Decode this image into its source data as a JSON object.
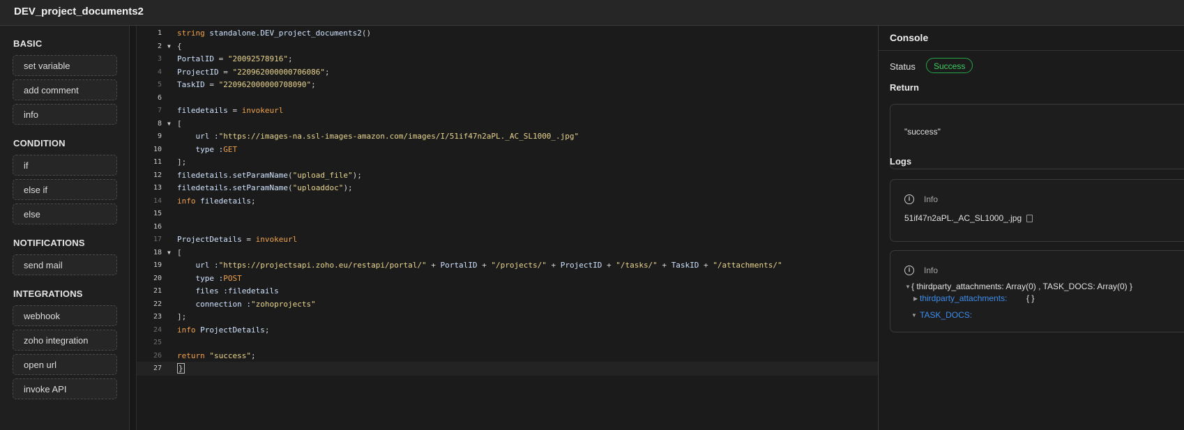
{
  "window": {
    "title": "DEV_project_documents2"
  },
  "sidebar": {
    "sections": [
      {
        "title": "BASIC",
        "items": [
          "set variable",
          "add comment",
          "info"
        ]
      },
      {
        "title": "CONDITION",
        "items": [
          "if",
          "else if",
          "else"
        ]
      },
      {
        "title": "NOTIFICATIONS",
        "items": [
          "send mail"
        ]
      },
      {
        "title": "INTEGRATIONS",
        "items": [
          "webhook",
          "zoho integration",
          "open url",
          "invoke API"
        ]
      }
    ]
  },
  "editor": {
    "lines": [
      {
        "n": "1",
        "fold": false,
        "segments": [
          {
            "t": "string ",
            "c": "kw"
          },
          {
            "t": "standalone.DEV_project_documents2",
            "c": "id"
          },
          {
            "t": "()",
            "c": ""
          }
        ]
      },
      {
        "n": "2",
        "fold": true,
        "segments": [
          {
            "t": "{",
            "c": ""
          }
        ]
      },
      {
        "n": "3",
        "fold": false,
        "segments": [
          {
            "t": "PortalID",
            "c": "id"
          },
          {
            "t": " = ",
            "c": ""
          },
          {
            "t": "\"20092578916\"",
            "c": "str"
          },
          {
            "t": ";",
            "c": ""
          }
        ]
      },
      {
        "n": "4",
        "fold": false,
        "segments": [
          {
            "t": "ProjectID",
            "c": "id"
          },
          {
            "t": " = ",
            "c": ""
          },
          {
            "t": "\"220962000000706086\"",
            "c": "str"
          },
          {
            "t": ";",
            "c": ""
          }
        ]
      },
      {
        "n": "5",
        "fold": false,
        "segments": [
          {
            "t": "TaskID",
            "c": "id"
          },
          {
            "t": " = ",
            "c": ""
          },
          {
            "t": "\"220962000000708090\"",
            "c": "str"
          },
          {
            "t": ";",
            "c": ""
          }
        ]
      },
      {
        "n": "6",
        "fold": false,
        "segments": []
      },
      {
        "n": "7",
        "fold": false,
        "segments": [
          {
            "t": "filedetails",
            "c": "id"
          },
          {
            "t": " = ",
            "c": ""
          },
          {
            "t": "invokeurl",
            "c": "kw"
          }
        ]
      },
      {
        "n": "8",
        "fold": true,
        "segments": [
          {
            "t": "[",
            "c": ""
          }
        ]
      },
      {
        "n": "9",
        "fold": false,
        "segments": [
          {
            "t": "    url :",
            "c": "id"
          },
          {
            "t": "\"https://images-na.ssl-images-amazon.com/images/I/51if47n2aPL._AC_SL1000_.jpg\"",
            "c": "str"
          }
        ]
      },
      {
        "n": "10",
        "fold": false,
        "segments": [
          {
            "t": "    type :",
            "c": "id"
          },
          {
            "t": "GET",
            "c": "kw"
          }
        ]
      },
      {
        "n": "11",
        "fold": false,
        "segments": [
          {
            "t": "];",
            "c": ""
          }
        ]
      },
      {
        "n": "12",
        "fold": false,
        "segments": [
          {
            "t": "filedetails.setParamName",
            "c": "id"
          },
          {
            "t": "(",
            "c": ""
          },
          {
            "t": "\"upload_file\"",
            "c": "str"
          },
          {
            "t": ");",
            "c": ""
          }
        ]
      },
      {
        "n": "13",
        "fold": false,
        "segments": [
          {
            "t": "filedetails.setParamName",
            "c": "id"
          },
          {
            "t": "(",
            "c": ""
          },
          {
            "t": "\"uploaddoc\"",
            "c": "str"
          },
          {
            "t": ");",
            "c": ""
          }
        ]
      },
      {
        "n": "14",
        "fold": false,
        "segments": [
          {
            "t": "info ",
            "c": "kw"
          },
          {
            "t": "filedetails",
            "c": "id"
          },
          {
            "t": ";",
            "c": ""
          }
        ]
      },
      {
        "n": "15",
        "fold": false,
        "segments": []
      },
      {
        "n": "16",
        "fold": false,
        "segments": []
      },
      {
        "n": "17",
        "fold": false,
        "segments": [
          {
            "t": "ProjectDetails",
            "c": "id"
          },
          {
            "t": " = ",
            "c": ""
          },
          {
            "t": "invokeurl",
            "c": "kw"
          }
        ]
      },
      {
        "n": "18",
        "fold": true,
        "segments": [
          {
            "t": "[",
            "c": ""
          }
        ]
      },
      {
        "n": "19",
        "fold": false,
        "segments": [
          {
            "t": "    url :",
            "c": "id"
          },
          {
            "t": "\"https://projectsapi.zoho.eu/restapi/portal/\"",
            "c": "str"
          },
          {
            "t": " + ",
            "c": ""
          },
          {
            "t": "PortalID",
            "c": "id"
          },
          {
            "t": " + ",
            "c": ""
          },
          {
            "t": "\"/projects/\"",
            "c": "str"
          },
          {
            "t": " + ",
            "c": ""
          },
          {
            "t": "ProjectID",
            "c": "id"
          },
          {
            "t": " + ",
            "c": ""
          },
          {
            "t": "\"/tasks/\"",
            "c": "str"
          },
          {
            "t": " + ",
            "c": ""
          },
          {
            "t": "TaskID",
            "c": "id"
          },
          {
            "t": " + ",
            "c": ""
          },
          {
            "t": "\"/attachments/\"",
            "c": "str"
          }
        ]
      },
      {
        "n": "20",
        "fold": false,
        "segments": [
          {
            "t": "    type :",
            "c": "id"
          },
          {
            "t": "POST",
            "c": "kw"
          }
        ]
      },
      {
        "n": "21",
        "fold": false,
        "segments": [
          {
            "t": "    files :",
            "c": "id"
          },
          {
            "t": "filedetails",
            "c": "id"
          }
        ]
      },
      {
        "n": "22",
        "fold": false,
        "segments": [
          {
            "t": "    connection :",
            "c": "id"
          },
          {
            "t": "\"zohoprojects\"",
            "c": "str"
          }
        ]
      },
      {
        "n": "23",
        "fold": false,
        "segments": [
          {
            "t": "];",
            "c": ""
          }
        ]
      },
      {
        "n": "24",
        "fold": false,
        "segments": [
          {
            "t": "info ",
            "c": "kw"
          },
          {
            "t": "ProjectDetails",
            "c": "id"
          },
          {
            "t": ";",
            "c": ""
          }
        ]
      },
      {
        "n": "25",
        "fold": false,
        "segments": []
      },
      {
        "n": "26",
        "fold": false,
        "segments": [
          {
            "t": "return ",
            "c": "kw"
          },
          {
            "t": "\"success\"",
            "c": "str"
          },
          {
            "t": ";",
            "c": ""
          }
        ]
      },
      {
        "n": "27",
        "fold": false,
        "segments": [
          {
            "t": "}",
            "c": "cursor"
          }
        ]
      }
    ],
    "dim_line_numbers": [
      "3",
      "4",
      "5",
      "7",
      "14",
      "17",
      "24",
      "25",
      "26"
    ],
    "active_line": "27"
  },
  "console": {
    "title": "Console",
    "status_label": "Status",
    "status_value": "Success",
    "return_label": "Return",
    "return_value": "\"success\"",
    "logs_label": "Logs",
    "log1": {
      "level": "Info",
      "text": "51if47n2aPL._AC_SL1000_.jpg"
    },
    "log2": {
      "level": "Info",
      "summary": "{ thirdparty_attachments: Array(0) , TASK_DOCS: Array(0) }",
      "key1": "thirdparty_attachments:",
      "key1_value": "{ }",
      "key2": "TASK_DOCS:"
    }
  },
  "colors": {
    "success": "#3fcf63",
    "link": "#3d8ef0",
    "keyword": "#f0a24a",
    "string": "#e9d48f"
  }
}
